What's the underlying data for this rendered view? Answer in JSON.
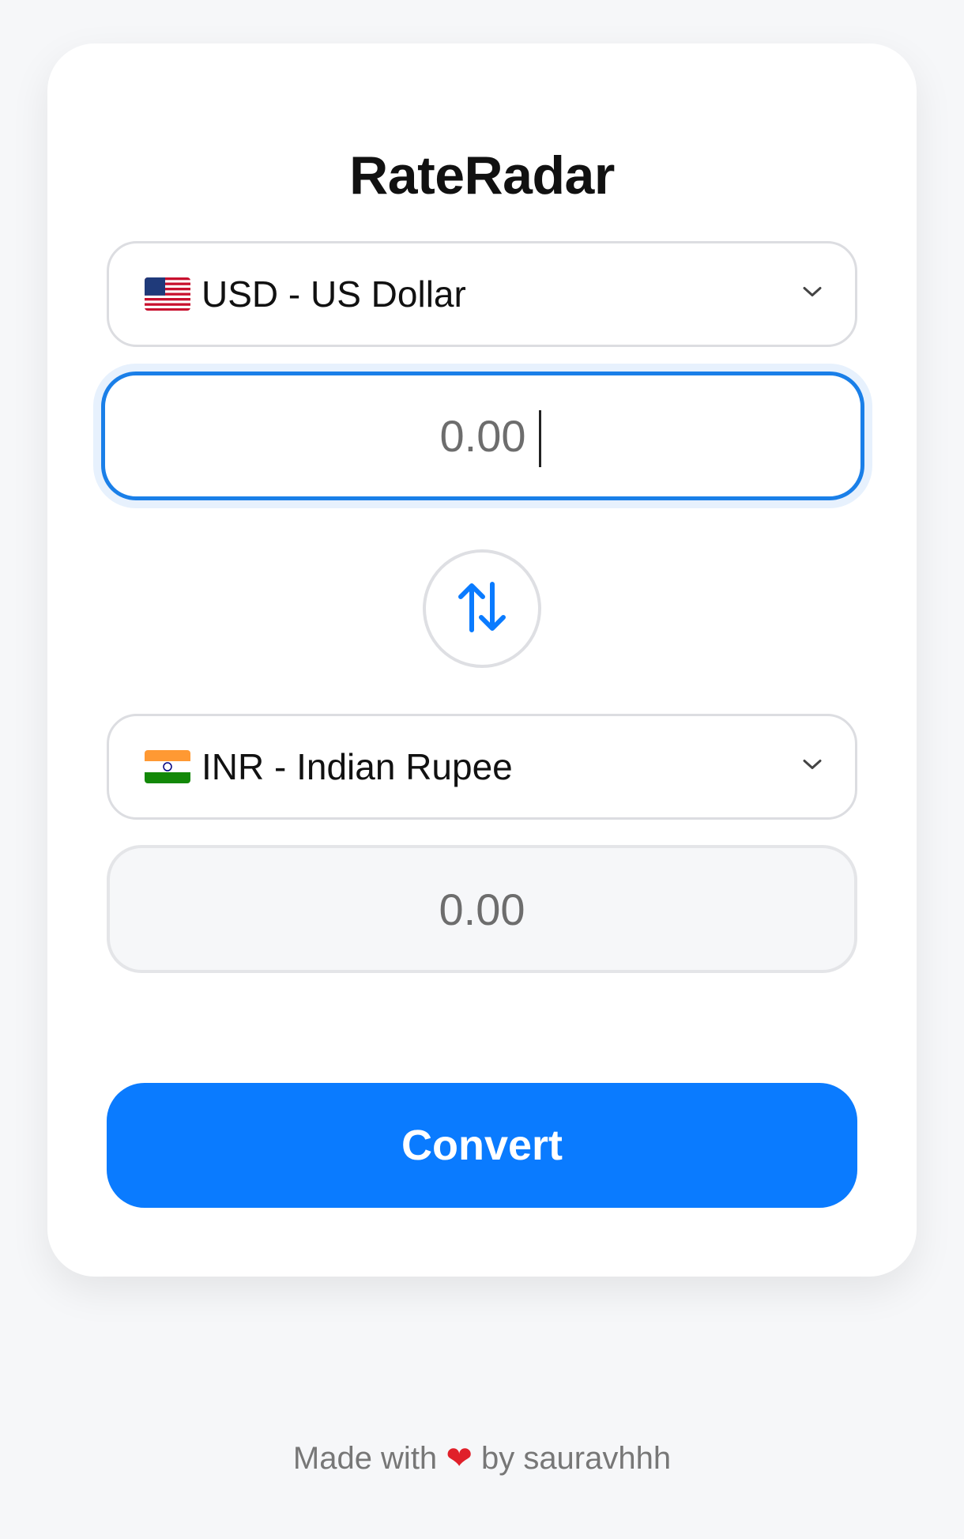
{
  "app": {
    "title": "RateRadar"
  },
  "from": {
    "currency_label": "USD - US Dollar",
    "flag_icon": "us-flag",
    "amount_placeholder": "0.00"
  },
  "to": {
    "currency_label": "INR - Indian Rupee",
    "flag_icon": "india-flag",
    "result_placeholder": "0.00"
  },
  "actions": {
    "convert_label": "Convert",
    "swap_icon": "swap-arrows-icon"
  },
  "footer": {
    "prefix": "Made with",
    "heart": "❤",
    "suffix": "by sauravhhh"
  },
  "colors": {
    "accent": "#0a7bff",
    "focus_border": "#1a7fe8",
    "background": "#f6f7f9"
  }
}
